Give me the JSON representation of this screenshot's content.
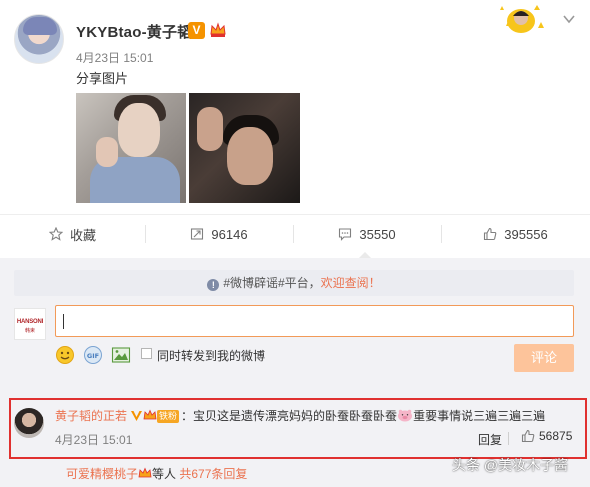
{
  "post": {
    "author": "YKYBtao-黄子韬",
    "verified_badge": "V",
    "time": "4月23日 15:01",
    "text": "分享图片",
    "images": [
      "photo-1",
      "photo-2"
    ],
    "icons": {
      "avatar": "user-avatar",
      "crown": "crown-icon",
      "top_right": "decor-sticker",
      "menu": "chevron-down-icon"
    }
  },
  "actions": {
    "favorite": {
      "label": "收藏",
      "icon": "star-icon"
    },
    "forward": {
      "count": "96146",
      "icon": "forward-icon"
    },
    "comment": {
      "count": "35550",
      "icon": "comment-icon"
    },
    "like": {
      "count": "395556",
      "icon": "thumbs-up-icon"
    }
  },
  "comment_box": {
    "notice_prefix": "#微博辟谣#平台，",
    "notice_link": "欢迎查阅！",
    "avatar_text": "HANSONI",
    "avatar_sub": "韩束",
    "input_value": "",
    "tools": [
      "emoji-icon",
      "gif-icon",
      "image-icon"
    ],
    "also_forward_label": "同时转发到我的微博",
    "submit_label": "评论"
  },
  "top_comment": {
    "name": "黄子韬的正若",
    "fan_badge": "铁粉",
    "separator": "：",
    "text": "宝贝这是遗传漂亮妈妈的卧蚕卧蚕卧蚕",
    "text_after": "重要事情说三遍三遍三遍",
    "time": "4月23日 15:01",
    "reply_label": "回复",
    "likes": "56875"
  },
  "sub_reply": {
    "name": "可爱精樱桃子",
    "mid": "等人",
    "count_text": "共677条回复"
  },
  "watermark": "头条 @美妆木子酱",
  "colors": {
    "accent": "#eb7350",
    "highlight_border": "#e0312f",
    "vip": "#f59300",
    "submit_disabled": "#fdc49b"
  }
}
